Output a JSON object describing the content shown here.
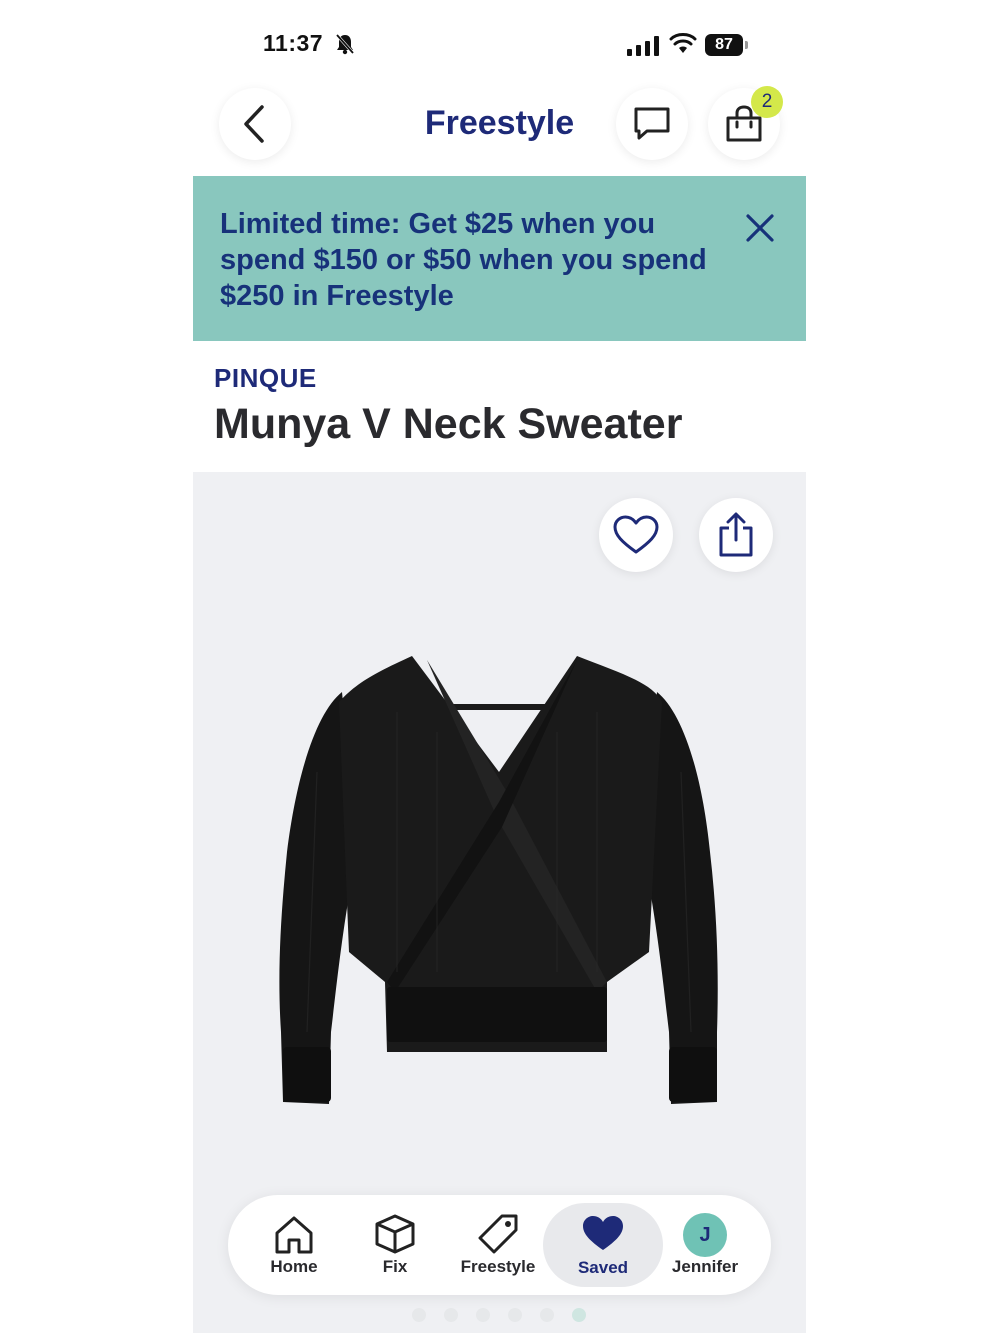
{
  "status_bar": {
    "time": "11:37",
    "battery": "87"
  },
  "header": {
    "title": "Freestyle",
    "bag_count": "2"
  },
  "promo": {
    "text": "Limited time: Get $25 when you spend $150 or $50 when you spend $250 in Freestyle"
  },
  "product": {
    "brand": "PINQUE",
    "name": "Munya V Neck Sweater"
  },
  "nav": {
    "items": [
      {
        "label": "Home",
        "icon": "home-icon"
      },
      {
        "label": "Fix",
        "icon": "box-icon"
      },
      {
        "label": "Freestyle",
        "icon": "tag-icon"
      },
      {
        "label": "Saved",
        "icon": "heart-icon",
        "active": true
      },
      {
        "label": "Jennifer",
        "icon": "avatar",
        "initial": "J"
      }
    ]
  },
  "colors": {
    "brand": "#1e2a78",
    "promo_bg": "#89c7be",
    "badge": "#d4e84a",
    "avatar": "#6fc2b5"
  }
}
